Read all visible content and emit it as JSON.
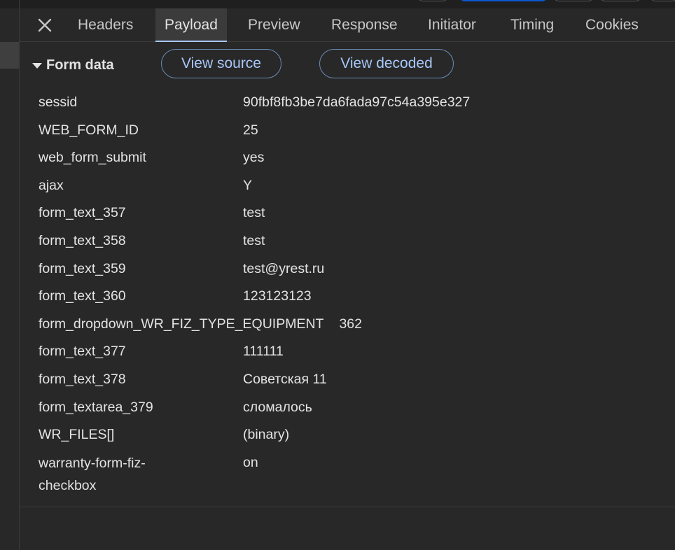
{
  "tabs": [
    {
      "label": "Headers",
      "active": false
    },
    {
      "label": "Payload",
      "active": true
    },
    {
      "label": "Preview",
      "active": false
    },
    {
      "label": "Response",
      "active": false
    },
    {
      "label": "Initiator",
      "active": false
    },
    {
      "label": "Timing",
      "active": false
    },
    {
      "label": "Cookies",
      "active": false
    }
  ],
  "section": {
    "title": "Form data",
    "view_source_label": "View source",
    "view_decoded_label": "View decoded"
  },
  "form_data": [
    {
      "key": "sessid",
      "value": "90fbf8fb3be7da6fada97c54a395e327"
    },
    {
      "key": "WEB_FORM_ID",
      "value": "25"
    },
    {
      "key": "web_form_submit",
      "value": "yes"
    },
    {
      "key": "ajax",
      "value": "Y"
    },
    {
      "key": "form_text_357",
      "value": "test"
    },
    {
      "key": "form_text_358",
      "value": "test"
    },
    {
      "key": "form_text_359",
      "value": "test@yrest.ru"
    },
    {
      "key": "form_text_360",
      "value": "123123123"
    },
    {
      "key": "form_dropdown_WR_FIZ_TYPE_EQUIPMENT",
      "value": "362"
    },
    {
      "key": "form_text_377",
      "value": "111111"
    },
    {
      "key": "form_text_378",
      "value": "Советская 11"
    },
    {
      "key": "form_textarea_379",
      "value": "сломалось"
    },
    {
      "key": "WR_FILES[]",
      "value": "(binary)"
    },
    {
      "key": "warranty-form-fiz-checkbox",
      "value": "on"
    }
  ],
  "colors": {
    "background": "#282828",
    "accent": "#a8c7fa",
    "text": "#e3e3e3"
  }
}
